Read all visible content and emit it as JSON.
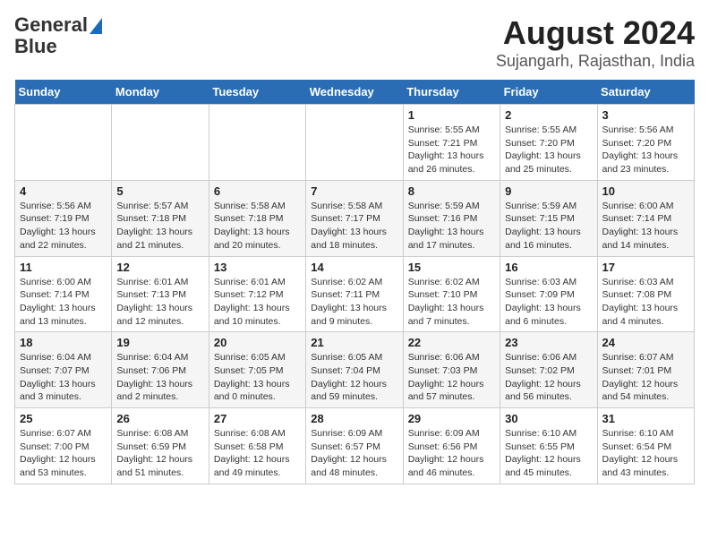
{
  "logo": {
    "line1": "General",
    "line2": "Blue"
  },
  "title": "August 2024",
  "subtitle": "Sujangarh, Rajasthan, India",
  "days_of_week": [
    "Sunday",
    "Monday",
    "Tuesday",
    "Wednesday",
    "Thursday",
    "Friday",
    "Saturday"
  ],
  "weeks": [
    [
      {
        "day": "",
        "sunrise": "",
        "sunset": "",
        "daylight": ""
      },
      {
        "day": "",
        "sunrise": "",
        "sunset": "",
        "daylight": ""
      },
      {
        "day": "",
        "sunrise": "",
        "sunset": "",
        "daylight": ""
      },
      {
        "day": "",
        "sunrise": "",
        "sunset": "",
        "daylight": ""
      },
      {
        "day": "1",
        "sunrise": "Sunrise: 5:55 AM",
        "sunset": "Sunset: 7:21 PM",
        "daylight": "Daylight: 13 hours and 26 minutes."
      },
      {
        "day": "2",
        "sunrise": "Sunrise: 5:55 AM",
        "sunset": "Sunset: 7:20 PM",
        "daylight": "Daylight: 13 hours and 25 minutes."
      },
      {
        "day": "3",
        "sunrise": "Sunrise: 5:56 AM",
        "sunset": "Sunset: 7:20 PM",
        "daylight": "Daylight: 13 hours and 23 minutes."
      }
    ],
    [
      {
        "day": "4",
        "sunrise": "Sunrise: 5:56 AM",
        "sunset": "Sunset: 7:19 PM",
        "daylight": "Daylight: 13 hours and 22 minutes."
      },
      {
        "day": "5",
        "sunrise": "Sunrise: 5:57 AM",
        "sunset": "Sunset: 7:18 PM",
        "daylight": "Daylight: 13 hours and 21 minutes."
      },
      {
        "day": "6",
        "sunrise": "Sunrise: 5:58 AM",
        "sunset": "Sunset: 7:18 PM",
        "daylight": "Daylight: 13 hours and 20 minutes."
      },
      {
        "day": "7",
        "sunrise": "Sunrise: 5:58 AM",
        "sunset": "Sunset: 7:17 PM",
        "daylight": "Daylight: 13 hours and 18 minutes."
      },
      {
        "day": "8",
        "sunrise": "Sunrise: 5:59 AM",
        "sunset": "Sunset: 7:16 PM",
        "daylight": "Daylight: 13 hours and 17 minutes."
      },
      {
        "day": "9",
        "sunrise": "Sunrise: 5:59 AM",
        "sunset": "Sunset: 7:15 PM",
        "daylight": "Daylight: 13 hours and 16 minutes."
      },
      {
        "day": "10",
        "sunrise": "Sunrise: 6:00 AM",
        "sunset": "Sunset: 7:14 PM",
        "daylight": "Daylight: 13 hours and 14 minutes."
      }
    ],
    [
      {
        "day": "11",
        "sunrise": "Sunrise: 6:00 AM",
        "sunset": "Sunset: 7:14 PM",
        "daylight": "Daylight: 13 hours and 13 minutes."
      },
      {
        "day": "12",
        "sunrise": "Sunrise: 6:01 AM",
        "sunset": "Sunset: 7:13 PM",
        "daylight": "Daylight: 13 hours and 12 minutes."
      },
      {
        "day": "13",
        "sunrise": "Sunrise: 6:01 AM",
        "sunset": "Sunset: 7:12 PM",
        "daylight": "Daylight: 13 hours and 10 minutes."
      },
      {
        "day": "14",
        "sunrise": "Sunrise: 6:02 AM",
        "sunset": "Sunset: 7:11 PM",
        "daylight": "Daylight: 13 hours and 9 minutes."
      },
      {
        "day": "15",
        "sunrise": "Sunrise: 6:02 AM",
        "sunset": "Sunset: 7:10 PM",
        "daylight": "Daylight: 13 hours and 7 minutes."
      },
      {
        "day": "16",
        "sunrise": "Sunrise: 6:03 AM",
        "sunset": "Sunset: 7:09 PM",
        "daylight": "Daylight: 13 hours and 6 minutes."
      },
      {
        "day": "17",
        "sunrise": "Sunrise: 6:03 AM",
        "sunset": "Sunset: 7:08 PM",
        "daylight": "Daylight: 13 hours and 4 minutes."
      }
    ],
    [
      {
        "day": "18",
        "sunrise": "Sunrise: 6:04 AM",
        "sunset": "Sunset: 7:07 PM",
        "daylight": "Daylight: 13 hours and 3 minutes."
      },
      {
        "day": "19",
        "sunrise": "Sunrise: 6:04 AM",
        "sunset": "Sunset: 7:06 PM",
        "daylight": "Daylight: 13 hours and 2 minutes."
      },
      {
        "day": "20",
        "sunrise": "Sunrise: 6:05 AM",
        "sunset": "Sunset: 7:05 PM",
        "daylight": "Daylight: 13 hours and 0 minutes."
      },
      {
        "day": "21",
        "sunrise": "Sunrise: 6:05 AM",
        "sunset": "Sunset: 7:04 PM",
        "daylight": "Daylight: 12 hours and 59 minutes."
      },
      {
        "day": "22",
        "sunrise": "Sunrise: 6:06 AM",
        "sunset": "Sunset: 7:03 PM",
        "daylight": "Daylight: 12 hours and 57 minutes."
      },
      {
        "day": "23",
        "sunrise": "Sunrise: 6:06 AM",
        "sunset": "Sunset: 7:02 PM",
        "daylight": "Daylight: 12 hours and 56 minutes."
      },
      {
        "day": "24",
        "sunrise": "Sunrise: 6:07 AM",
        "sunset": "Sunset: 7:01 PM",
        "daylight": "Daylight: 12 hours and 54 minutes."
      }
    ],
    [
      {
        "day": "25",
        "sunrise": "Sunrise: 6:07 AM",
        "sunset": "Sunset: 7:00 PM",
        "daylight": "Daylight: 12 hours and 53 minutes."
      },
      {
        "day": "26",
        "sunrise": "Sunrise: 6:08 AM",
        "sunset": "Sunset: 6:59 PM",
        "daylight": "Daylight: 12 hours and 51 minutes."
      },
      {
        "day": "27",
        "sunrise": "Sunrise: 6:08 AM",
        "sunset": "Sunset: 6:58 PM",
        "daylight": "Daylight: 12 hours and 49 minutes."
      },
      {
        "day": "28",
        "sunrise": "Sunrise: 6:09 AM",
        "sunset": "Sunset: 6:57 PM",
        "daylight": "Daylight: 12 hours and 48 minutes."
      },
      {
        "day": "29",
        "sunrise": "Sunrise: 6:09 AM",
        "sunset": "Sunset: 6:56 PM",
        "daylight": "Daylight: 12 hours and 46 minutes."
      },
      {
        "day": "30",
        "sunrise": "Sunrise: 6:10 AM",
        "sunset": "Sunset: 6:55 PM",
        "daylight": "Daylight: 12 hours and 45 minutes."
      },
      {
        "day": "31",
        "sunrise": "Sunrise: 6:10 AM",
        "sunset": "Sunset: 6:54 PM",
        "daylight": "Daylight: 12 hours and 43 minutes."
      }
    ]
  ]
}
